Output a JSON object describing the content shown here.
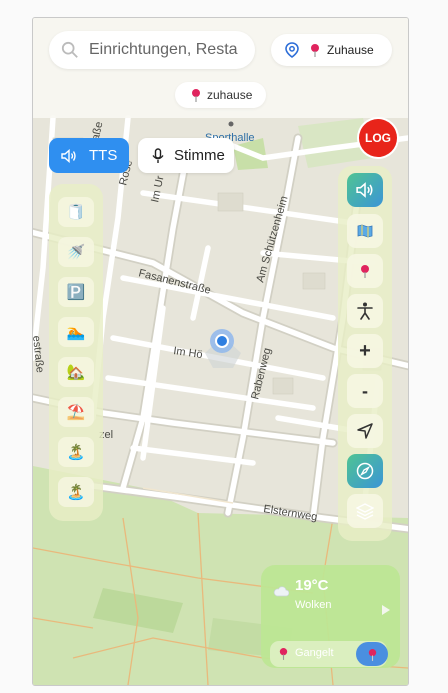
{
  "search": {
    "placeholder": "Einrichtungen, Resta"
  },
  "home_button": {
    "label": "Zuhause"
  },
  "saved_chip": {
    "label": "zuhause"
  },
  "tts_button": {
    "label": "TTS"
  },
  "voice_button": {
    "label": "Stimme"
  },
  "log_button": {
    "label": "LOG"
  },
  "map": {
    "labels": {
      "sporthalle": "Sporthalle",
      "fasanenstrasse": "Fasanenstraße",
      "im_hoe": "Im Hö",
      "am_schuetzenheim": "Am Schützenheim",
      "rabenweg": "Rabenweg",
      "elsternweg": "Elsternweg",
      "im_ur": "Im Ur",
      "rose": "Rose",
      "strasse_left": "estraße",
      "strasse_top": "straße",
      "zel": "zel"
    }
  },
  "left_panel": {
    "items": [
      {
        "icon": "toilet-icon",
        "glyph": "🧻"
      },
      {
        "icon": "shower-icon",
        "glyph": "🚿"
      },
      {
        "icon": "parking-icon",
        "glyph": "🅿️"
      },
      {
        "icon": "pool-icon",
        "glyph": "🏊"
      },
      {
        "icon": "house-icon",
        "glyph": "🏡"
      },
      {
        "icon": "beach-umbrella-icon",
        "glyph": "⛱️"
      },
      {
        "icon": "palm-tree-icon",
        "glyph": "🏝️"
      },
      {
        "icon": "palm-tree-icon",
        "glyph": "🏝️"
      }
    ]
  },
  "right_panel": {
    "items": [
      {
        "icon": "speaker-icon"
      },
      {
        "icon": "map-icon"
      },
      {
        "icon": "pin-icon"
      },
      {
        "icon": "accessibility-icon"
      },
      {
        "icon": "zoom-in-icon",
        "text": "+"
      },
      {
        "icon": "zoom-out-icon",
        "text": "-"
      },
      {
        "icon": "navigate-icon"
      },
      {
        "icon": "compass-icon"
      },
      {
        "icon": "layers-icon"
      }
    ]
  },
  "weather": {
    "temperature": "19°C",
    "condition": "Wolken",
    "place": "Gangelt"
  },
  "colors": {
    "accent": "#2f8ff0",
    "log": "#e8241a",
    "pin": "#e0245e",
    "weather_bg": "#bde694"
  }
}
